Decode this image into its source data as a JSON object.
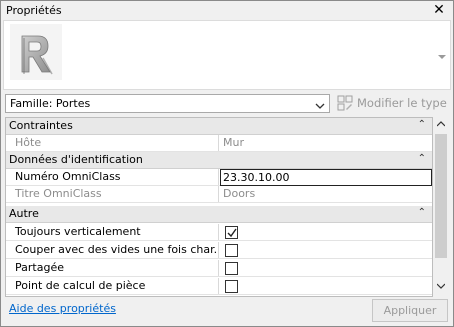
{
  "window": {
    "title": "Propriétés",
    "close_glyph": "✕"
  },
  "type_selector": {
    "icon": "revit-r-logo-icon",
    "logo_letter": "R"
  },
  "family_select": {
    "value": "Famille: Portes"
  },
  "edit_type": {
    "label": "Modifier le type",
    "icon": "edit-type-icon"
  },
  "groups": {
    "constraints": {
      "label": "Contraintes"
    },
    "identity": {
      "label": "Données d'identification"
    },
    "other": {
      "label": "Autre"
    }
  },
  "props": {
    "host": {
      "name": "Hôte",
      "value": "Mur"
    },
    "omniclass_number": {
      "name": "Numéro OmniClass",
      "value": "23.30.10.00"
    },
    "omniclass_title": {
      "name": "Titre OmniClass",
      "value": "Doors"
    },
    "always_vertical": {
      "name": "Toujours verticalement",
      "checked": true
    },
    "cut_with_voids": {
      "name": "Couper avec des vides une fois char...",
      "checked": false
    },
    "shared": {
      "name": "Partagée",
      "checked": false
    },
    "room_calc_point": {
      "name": "Point de calcul de pièce",
      "checked": false
    }
  },
  "footer": {
    "help_link": "Aide des propriétés",
    "apply_label": "Appliquer"
  }
}
